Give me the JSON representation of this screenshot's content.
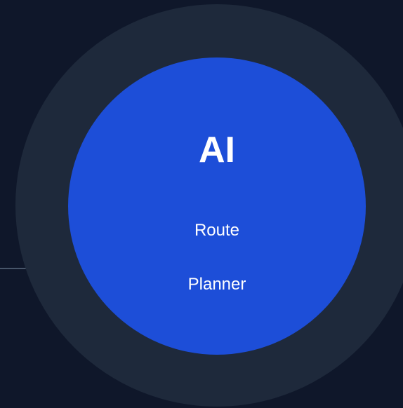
{
  "node": {
    "title": "AI",
    "lines": [
      "Route",
      "Planner"
    ]
  },
  "colors": {
    "background": "#0f172a",
    "ring": "#1e293b",
    "core": "#1d4ed8",
    "text": "#ffffff",
    "connector": "#475569"
  }
}
